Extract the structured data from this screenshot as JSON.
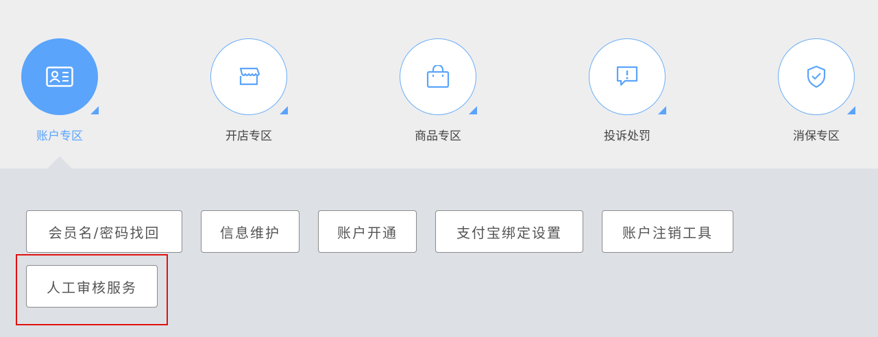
{
  "categories": [
    {
      "label": "账户专区",
      "icon": "id-card-icon",
      "active": true
    },
    {
      "label": "开店专区",
      "icon": "storefront-icon",
      "active": false
    },
    {
      "label": "商品专区",
      "icon": "shopping-bag-icon",
      "active": false
    },
    {
      "label": "投诉处罚",
      "icon": "alert-bubble-icon",
      "active": false
    },
    {
      "label": "消保专区",
      "icon": "shield-check-icon",
      "active": false
    }
  ],
  "services": [
    {
      "label": "会员名/密码找回"
    },
    {
      "label": "信息维护"
    },
    {
      "label": "账户开通"
    },
    {
      "label": "支付宝绑定设置"
    },
    {
      "label": "账户注销工具"
    },
    {
      "label": "人工审核服务"
    }
  ],
  "colors": {
    "accent": "#5aa4fb",
    "highlight": "#e01010",
    "top_bg": "#eeeeef",
    "panel_bg": "#dde1e6"
  }
}
